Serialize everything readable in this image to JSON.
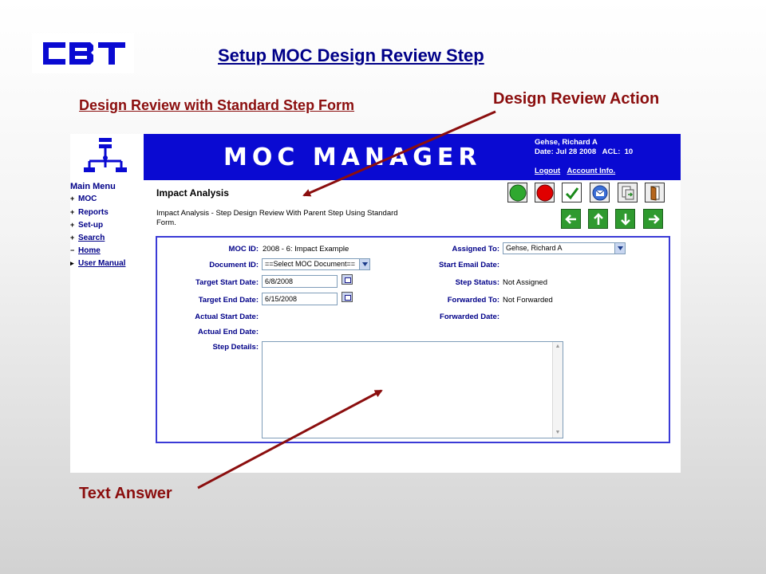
{
  "slide": {
    "logo_text": "CBT",
    "title": "Setup MOC Design Review Step",
    "subtitle": "Design Review with Standard Step Form",
    "callout_top": "Design Review Action",
    "callout_bottom": "Text Answer",
    "accent_blue": "#000088",
    "accent_red": "#8b0e0e"
  },
  "app": {
    "banner_title": "MOC MANAGER",
    "banner_color": "#0a0ad2",
    "user": {
      "name": "Gehse, Richard A",
      "date_line": "Date: Jul 28 2008   ACL:  10",
      "logout": "Logout",
      "account_info": "Account Info."
    },
    "menu": {
      "title": "Main Menu",
      "items": [
        {
          "bullet": "+",
          "label": "MOC",
          "underline": false
        },
        {
          "bullet": "+",
          "label": "Reports",
          "underline": false
        },
        {
          "bullet": "+",
          "label": "Set-up",
          "underline": false
        },
        {
          "bullet": "+",
          "label": "Search",
          "underline": true
        },
        {
          "bullet": "−",
          "label": "Home",
          "underline": true
        },
        {
          "bullet": "▸",
          "label": "User Manual",
          "underline": true
        }
      ]
    },
    "page": {
      "title": "Impact Analysis",
      "description": "Impact Analysis - Step Design Review With Parent Step Using Standard Form."
    },
    "toolbar_icons": [
      "green-circle-icon",
      "red-circle-icon",
      "checkmark-icon",
      "email-icon",
      "document-icon",
      "exit-door-icon"
    ],
    "nav_icons": [
      "arrow-left-icon",
      "arrow-up-icon",
      "arrow-down-icon",
      "arrow-right-icon"
    ],
    "form": {
      "moc_id_label": "MOC ID:",
      "moc_id_value": "2008 - 6: Impact Example",
      "document_id_label": "Document ID:",
      "document_id_value": "==Select MOC Document==",
      "target_start_label": "Target Start Date:",
      "target_start_value": "6/8/2008",
      "target_end_label": "Target End Date:",
      "target_end_value": "6/15/2008",
      "actual_start_label": "Actual Start Date:",
      "actual_end_label": "Actual End Date:",
      "step_details_label": "Step Details:",
      "assigned_to_label": "Assigned To:",
      "assigned_to_value": "Gehse, Richard A",
      "start_email_label": "Start Email Date:",
      "step_status_label": "Step Status:",
      "step_status_value": "Not Assigned",
      "forwarded_to_label": "Forwarded To:",
      "forwarded_to_value": "Not Forwarded",
      "forwarded_date_label": "Forwarded Date:"
    }
  }
}
